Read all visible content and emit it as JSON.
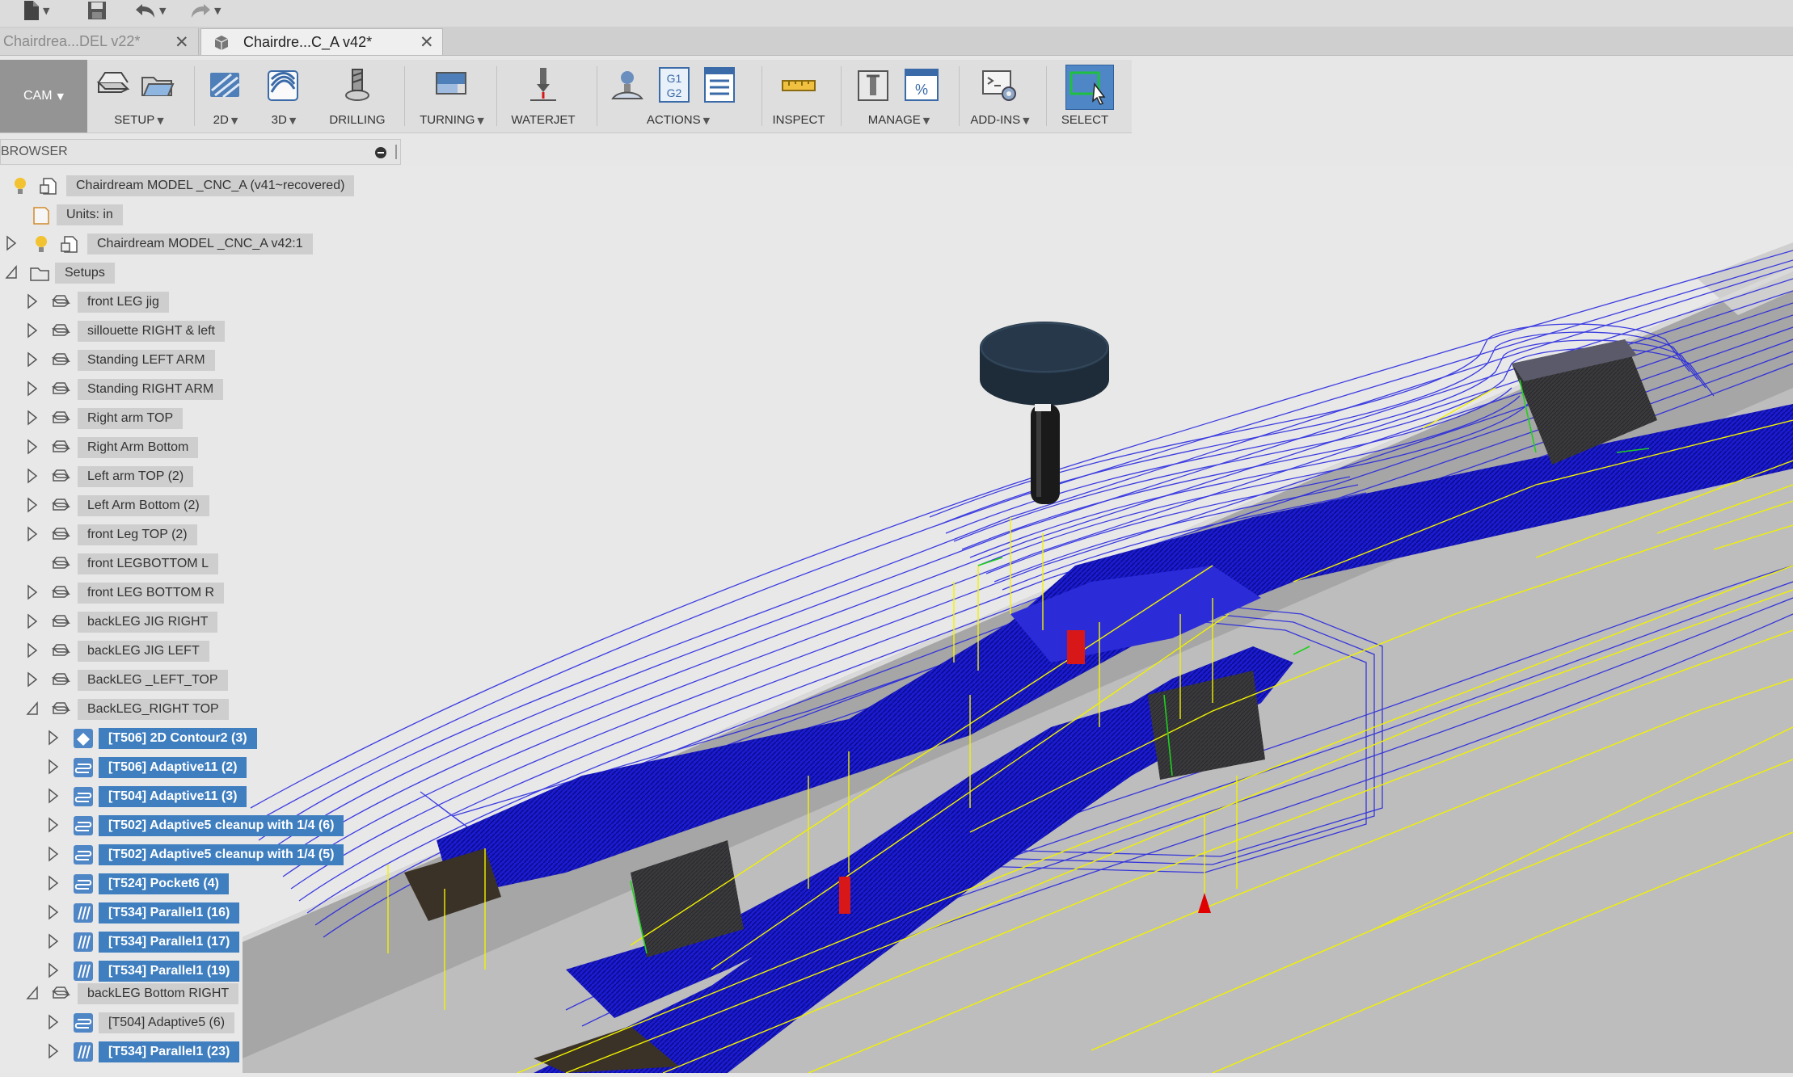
{
  "tabs": [
    {
      "label": "Chairdrea...DEL v22*"
    },
    {
      "label": "Chairdre...C_A v42*"
    }
  ],
  "toolbar": {
    "workspace": "CAM",
    "groups": [
      {
        "label": "SETUP"
      },
      {
        "label": "2D"
      },
      {
        "label": "3D"
      },
      {
        "label": "DRILLING"
      },
      {
        "label": "TURNING"
      },
      {
        "label": "WATERJET"
      },
      {
        "label": "ACTIONS"
      },
      {
        "label": "INSPECT"
      },
      {
        "label": "MANAGE"
      },
      {
        "label": "ADD-INS"
      },
      {
        "label": "SELECT"
      }
    ],
    "g1g2_text": [
      "G1",
      "G2"
    ],
    "percent_text": "%"
  },
  "browser": {
    "title": "BROWSER",
    "root": "Chairdream MODEL _CNC_A (v41~recovered)",
    "units": "Units: in",
    "model": "Chairdream MODEL _CNC_A v42:1",
    "setups_label": "Setups",
    "setups": [
      {
        "label": "front LEG jig"
      },
      {
        "label": "sillouette RIGHT & left"
      },
      {
        "label": "Standing LEFT ARM"
      },
      {
        "label": "Standing RIGHT ARM"
      },
      {
        "label": "Right arm TOP"
      },
      {
        "label": "Right Arm Bottom"
      },
      {
        "label": "Left arm TOP (2)"
      },
      {
        "label": "Left Arm Bottom (2)"
      },
      {
        "label": "front Leg TOP (2)"
      },
      {
        "label": "front LEGBOTTOM L"
      },
      {
        "label": "front LEG BOTTOM R"
      },
      {
        "label": "backLEG JIG RIGHT"
      },
      {
        "label": "backLEG JIG LEFT"
      },
      {
        "label": "BackLEG _LEFT_TOP"
      },
      {
        "label": "BackLEG_RIGHT TOP"
      }
    ],
    "operations_backleg_right_top": [
      {
        "label": "[T506] 2D Contour2 (3)"
      },
      {
        "label": "[T506] Adaptive11 (2)"
      },
      {
        "label": "[T504] Adaptive11 (3)"
      },
      {
        "label": "[T502] Adaptive5 cleanup with 1/4 (6)"
      },
      {
        "label": "[T502] Adaptive5 cleanup with 1/4 (5)"
      },
      {
        "label": "[T524] Pocket6 (4)"
      },
      {
        "label": "[T534] Parallel1 (16)"
      },
      {
        "label": "[T534] Parallel1 (17)"
      },
      {
        "label": "[T534] Parallel1 (19)"
      }
    ],
    "setup_backleg_bottom_right": "backLEG Bottom RIGHT",
    "operations_backleg_bottom_right": [
      {
        "label": "[T504] Adaptive5 (6)"
      },
      {
        "label": "[T534] Parallel1 (23)"
      }
    ]
  }
}
